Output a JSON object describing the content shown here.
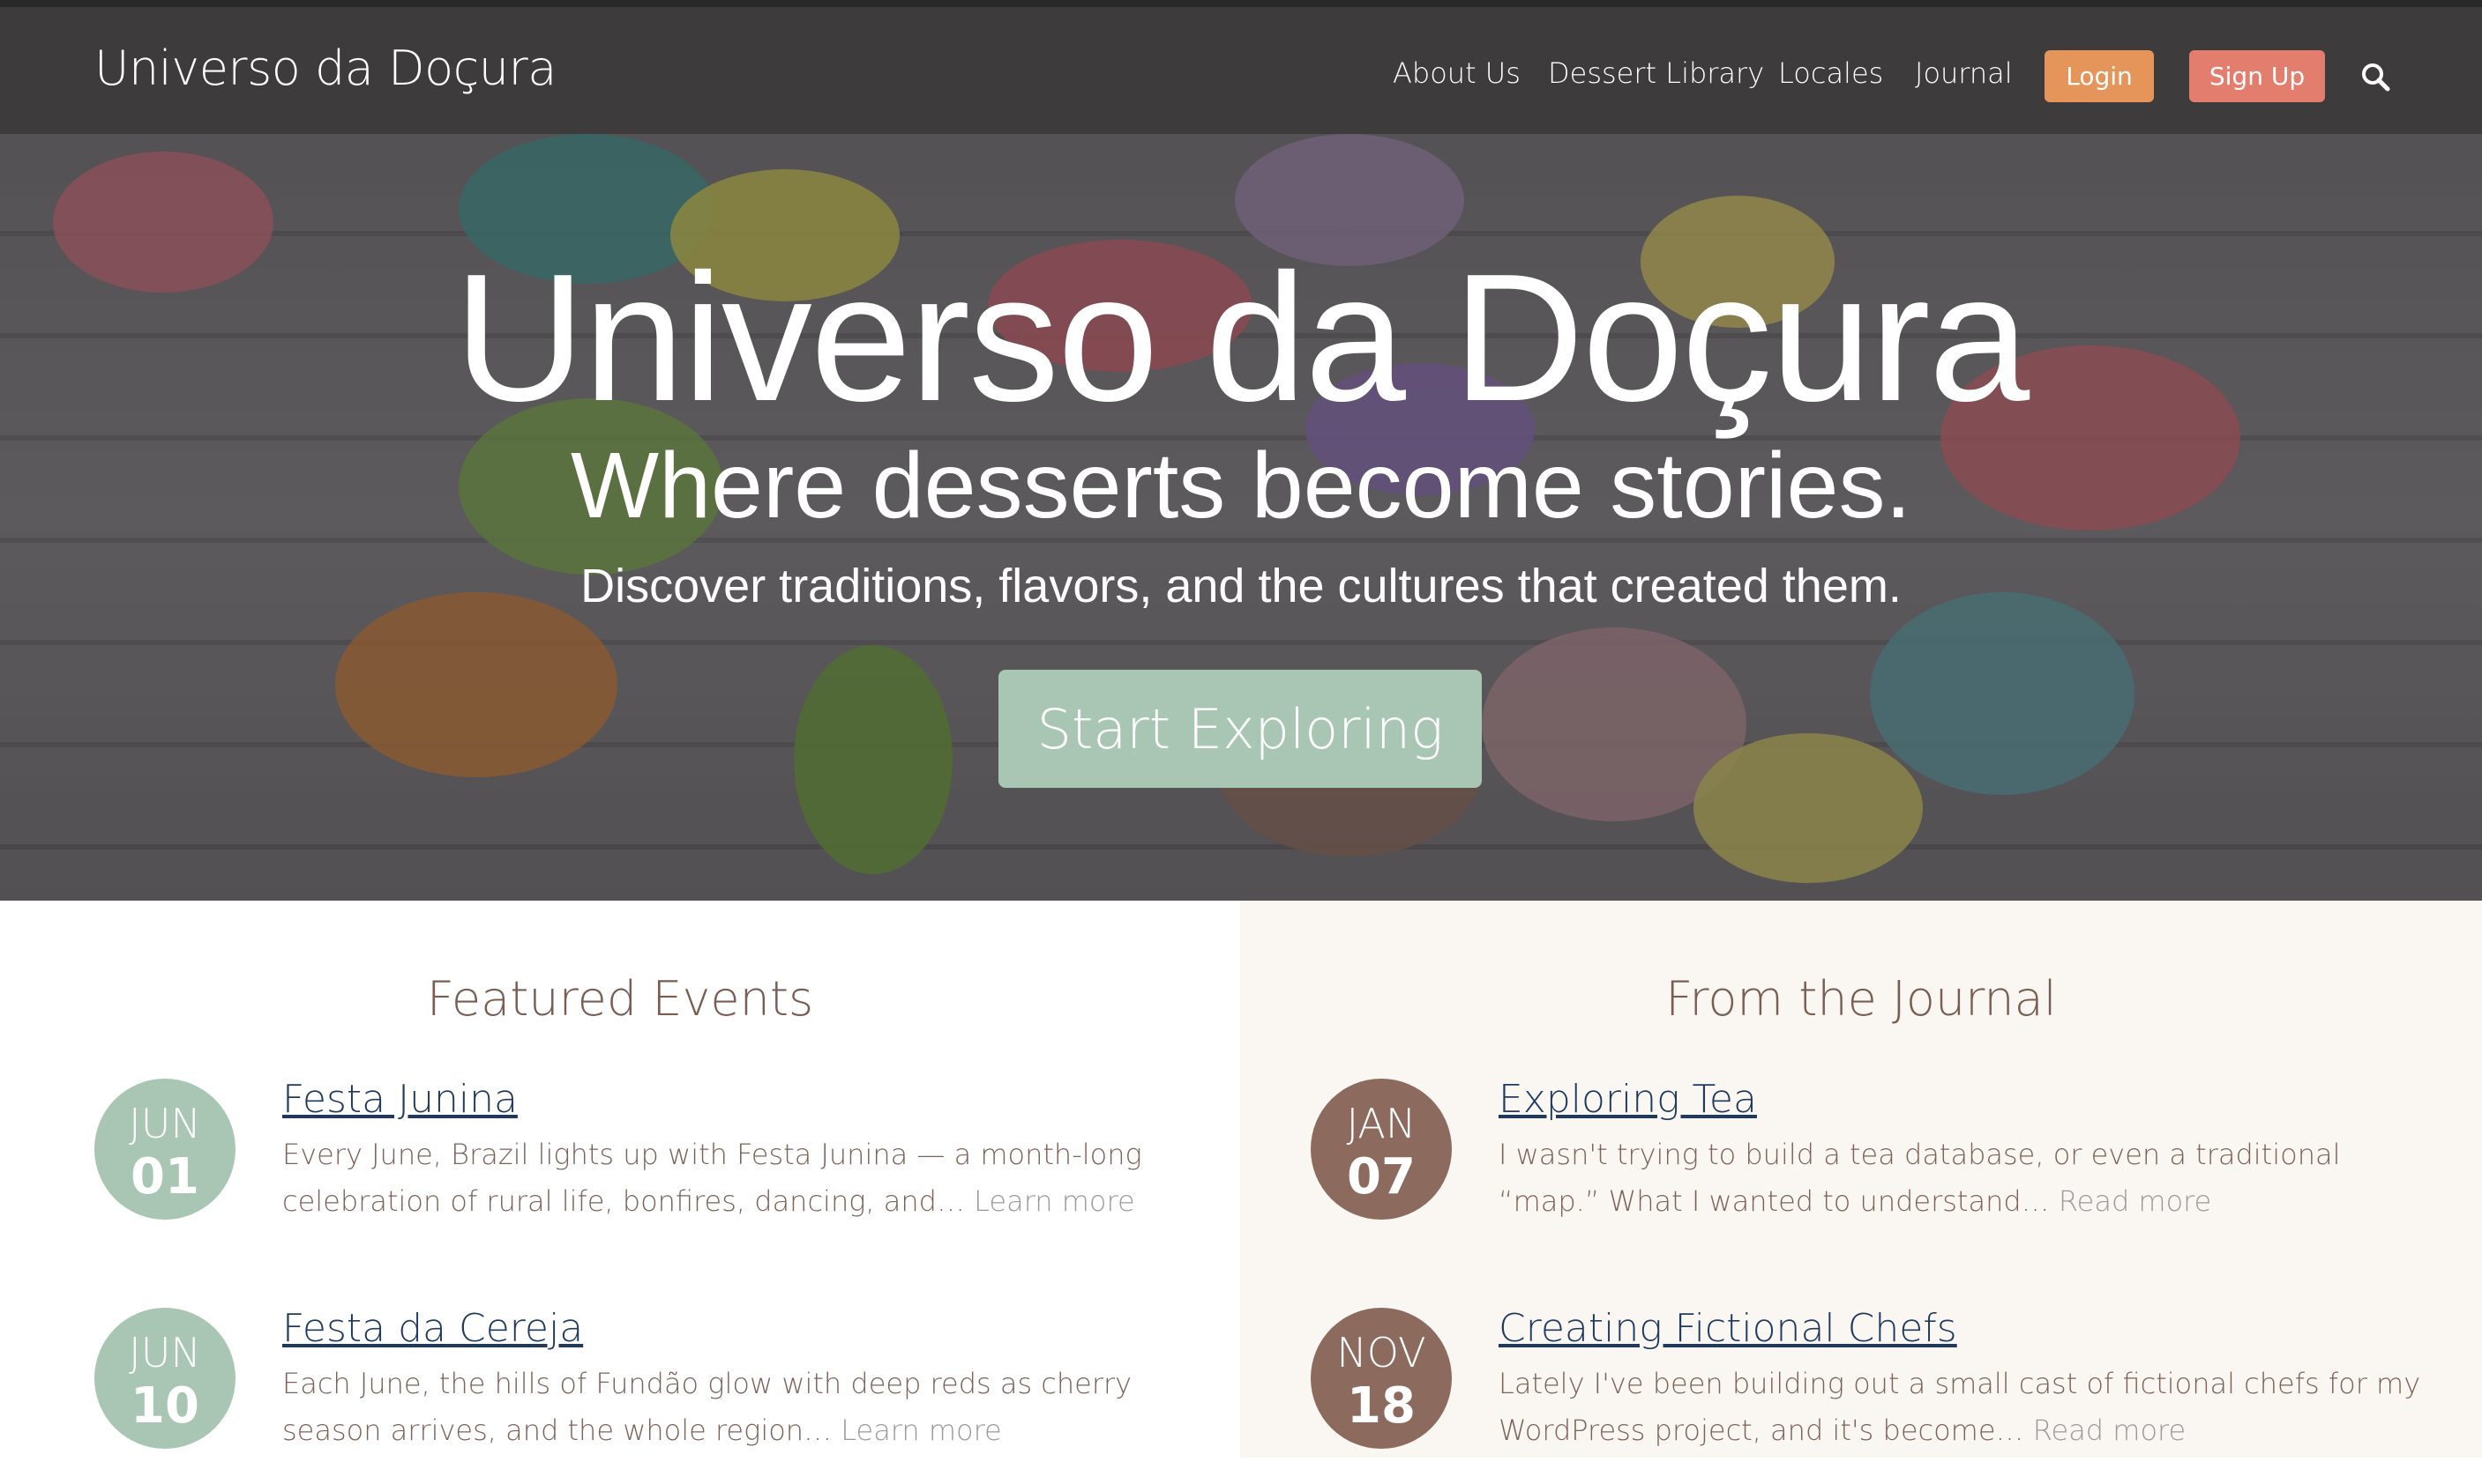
{
  "navbar": {
    "brand": "Universo da Doçura",
    "links": [
      "About Us",
      "Dessert Library",
      "Locales",
      "Journal"
    ],
    "login_label": "Login",
    "signup_label": "Sign Up",
    "search_icon": "search-icon",
    "colors": {
      "background": "#3d3b3c",
      "login": "#e5955a",
      "signup": "#e37e6e"
    }
  },
  "hero": {
    "title": "Universo da Doçura",
    "subtitle": "Where desserts become stories.",
    "tagline": "Discover traditions, flavors, and the cultures that created them.",
    "cta_label": "Start Exploring",
    "colors": {
      "cta": "#a9c6b5"
    }
  },
  "events": {
    "title": "Featured Events",
    "items": [
      {
        "month": "JUN",
        "day": "01",
        "title": "Festa Junina",
        "excerpt": "Every June, Brazil lights up with Festa Junina — a month-long celebration of rural life, bonfires, dancing, and…",
        "more": "Learn more"
      },
      {
        "month": "JUN",
        "day": "10",
        "title": "Festa da Cereja",
        "excerpt": "Each June, the hills of Fundão glow with deep reds as cherry season arrives, and the whole region…",
        "more": "Learn more"
      }
    ]
  },
  "journal": {
    "title": "From the Journal",
    "items": [
      {
        "month": "JAN",
        "day": "07",
        "title": "Exploring Tea",
        "excerpt": "I wasn't trying to build a tea database, or even a traditional “map.” What I wanted to understand…",
        "more": "Read more"
      },
      {
        "month": "NOV",
        "day": "18",
        "title": "Creating Fictional Chefs",
        "excerpt": "Lately I've been building out a small cast of fictional chefs for my WordPress project, and it's become…",
        "more": "Read more"
      }
    ]
  },
  "colors": {
    "heading": "#7a5d52",
    "link": "#1f3a5f",
    "badge_green": "#a9c6b5",
    "badge_brown": "#8c6b5e"
  }
}
